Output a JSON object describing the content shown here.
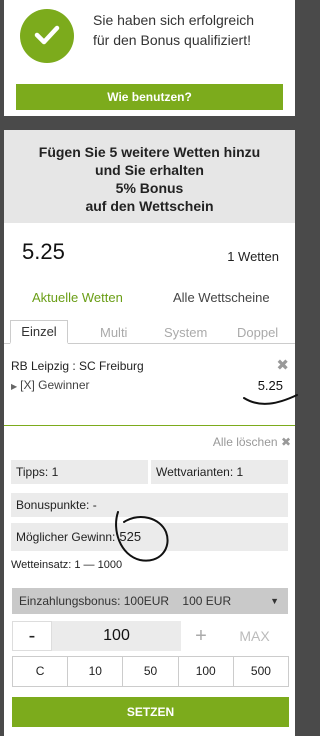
{
  "success": {
    "message_line1": "Sie haben sich erfolgreich",
    "message_line2": "für den Bonus qualifiziert!",
    "button_label": "Wie benutzen?"
  },
  "promo": {
    "line1": "Fügen Sie 5 weitere Wetten hinzu",
    "line2": "und Sie erhalten",
    "line3": "5% Bonus",
    "line4": "auf den Wettschein"
  },
  "summary": {
    "total": "5.25",
    "bet_count": "1 Wetten"
  },
  "tabs": {
    "current": "Aktuelle Wetten",
    "all": "Alle Wettscheine"
  },
  "subtabs": [
    "Einzel",
    "Multi",
    "System",
    "Doppel"
  ],
  "bet": {
    "match": "RB Leipzig : SC Freiburg",
    "selection": "[X] Gewinner",
    "odds": "5.25"
  },
  "clear_all": "Alle löschen",
  "info": {
    "tipps": "Tipps: 1",
    "varianten": "Wettvarianten: 1",
    "bonuspunkte": "Bonuspunkte: -",
    "gewinn_label": "Möglicher Gewinn:",
    "gewinn_value": "525"
  },
  "stake_range": "Wetteinsatz: 1 — 1000",
  "bonus_select": "Einzahlungsbonus: 100EUR    100 EUR",
  "stepper": {
    "minus": "-",
    "value": "100",
    "plus": "+",
    "max": "MAX"
  },
  "quick_amounts": [
    "C",
    "10",
    "50",
    "100",
    "500"
  ],
  "submit_label": "SETZEN",
  "colors": {
    "accent_green": "#7cab1c",
    "background": "#4a4a4a"
  }
}
